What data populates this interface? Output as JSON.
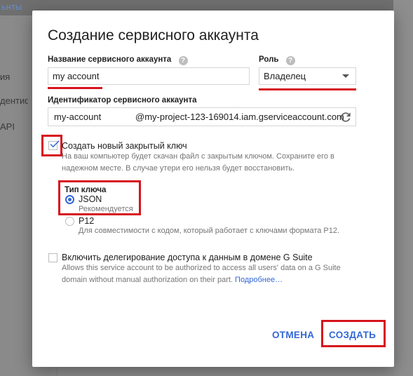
{
  "background": {
    "title_fragment": "ьнты",
    "sidebar_items": [
      "ия",
      "дентифи",
      "API"
    ]
  },
  "dialog": {
    "title": "Создание сервисного аккаунта",
    "name_field": {
      "label": "Название сервисного аккаунта",
      "value": "my account",
      "help_icon": "help-icon"
    },
    "role_field": {
      "label": "Роль",
      "value": "Владелец",
      "help_icon": "help-icon"
    },
    "id_field": {
      "label": "Идентификатор сервисного аккаунта",
      "value": "my-account",
      "domain": "@my-project-123-169014.iam.gserviceaccount.com",
      "refresh_icon": "refresh-icon"
    },
    "new_key": {
      "checked": true,
      "label": "Создать новый закрытый ключ",
      "hint_line1": "На ваш компьютер будет скачан файл с закрытым ключом. Сохраните его в",
      "hint_line2": "надежном месте. В случае утери его нельзя будет восстановить."
    },
    "key_type": {
      "label": "Тип ключа",
      "options": [
        {
          "label": "JSON",
          "hint": "Рекомендуется",
          "selected": true
        },
        {
          "label": "P12",
          "hint": "Для совместимости с кодом, который работает с ключами формата P12.",
          "selected": false
        }
      ]
    },
    "gsuite": {
      "checked": false,
      "label": "Включить делегирование доступа к данным в домене G Suite",
      "hint_line1": "Allows this service account to be authorized to access all users' data on a G Suite",
      "hint_line2": "domain without manual authorization on their part.",
      "learn_more": "Подробнее…"
    },
    "buttons": {
      "cancel": "ОТМЕНА",
      "create": "СОЗДАТЬ"
    }
  },
  "colors": {
    "accent": "#3367d6",
    "highlight": "#d7141d"
  }
}
